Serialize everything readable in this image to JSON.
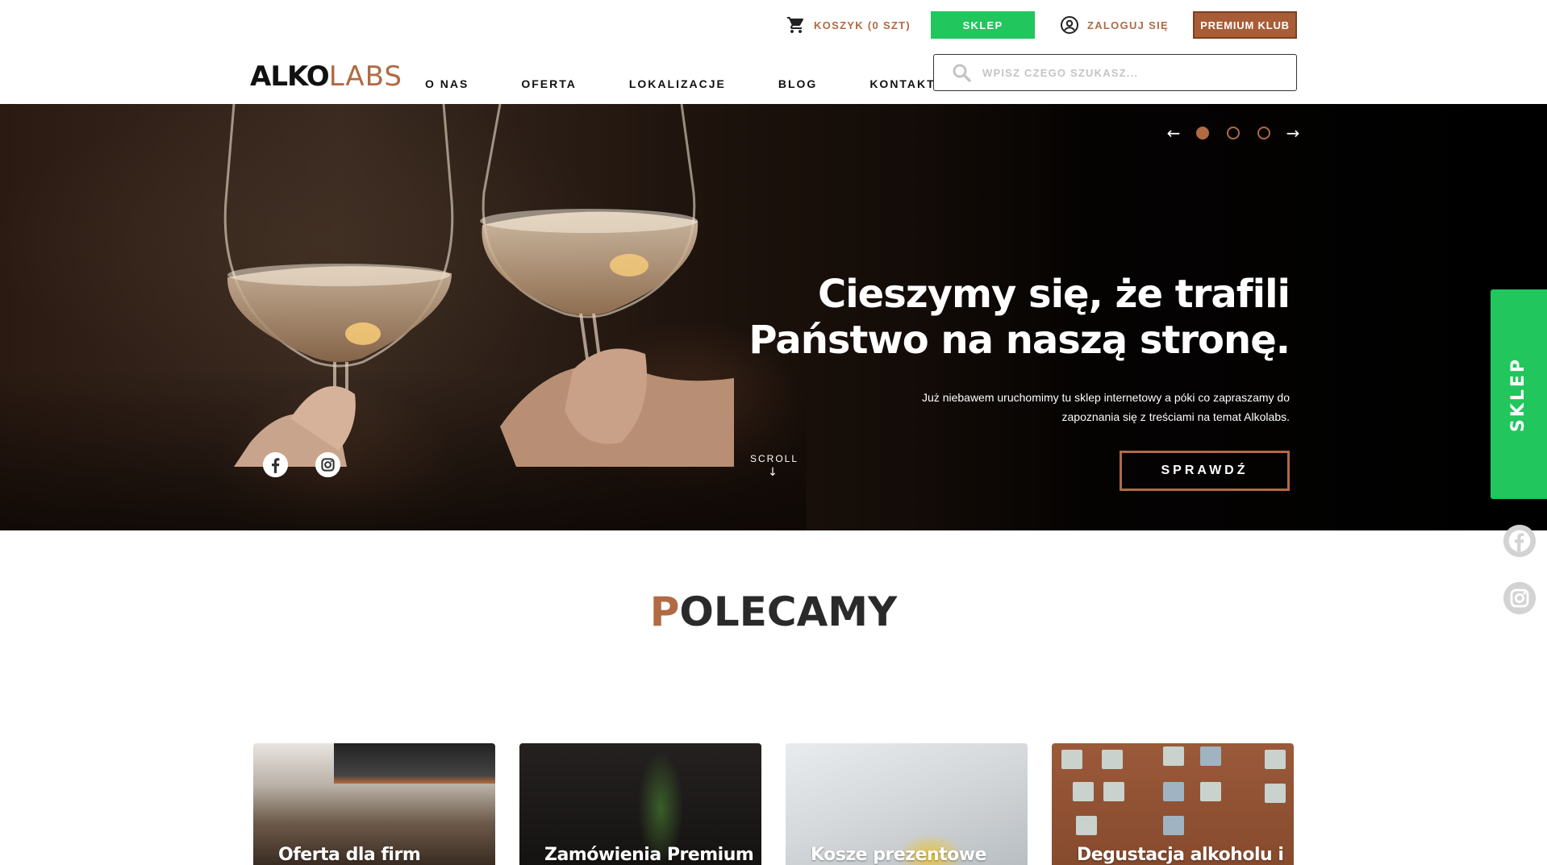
{
  "header": {
    "cart_label": "KOSZYK (0 SZT)",
    "shop_button": "SKLEP",
    "login_label": "ZALOGUJ SIĘ",
    "premium_button": "PREMIUM KLUB",
    "logo": {
      "bold_part": "ALKO",
      "light_part": "LABS"
    },
    "nav": [
      "O NAS",
      "OFERTA",
      "LOKALIZACJE",
      "BLOG",
      "KONTAKT"
    ],
    "search": {
      "placeholder": "WPISZ CZEGO SZUKASZ...",
      "value": ""
    }
  },
  "hero": {
    "title_line1": "Cieszymy się, że trafili",
    "title_line2": "Państwo na naszą stronę.",
    "text_line1": "Już niebawem uruchomimy tu sklep internetowy a póki co zapraszamy do",
    "text_line2": "zapoznania się z treściami na temat Alkolabs.",
    "cta": "SPRAWDŹ",
    "scroll_label": "SCROLL",
    "slides_total": 3,
    "active_slide": 1
  },
  "side": {
    "shop_label": "SKLEP"
  },
  "section": {
    "title_first_letter": "P",
    "title_rest": "OLECAMY"
  },
  "cards": [
    {
      "title": "Oferta dla firm"
    },
    {
      "title": "Zamówienia Premium"
    },
    {
      "title": "Kosze prezentowe"
    },
    {
      "title": "Degustacja alkoholu i"
    }
  ],
  "colors": {
    "accent_brown": "#b06a44",
    "green": "#21c65d",
    "premium_bg": "#a85d37"
  },
  "icons": [
    "cart-icon",
    "user-circle-icon",
    "search-icon",
    "arrow-left-icon",
    "arrow-right-icon",
    "facebook-icon",
    "instagram-icon",
    "arrow-down-icon"
  ]
}
